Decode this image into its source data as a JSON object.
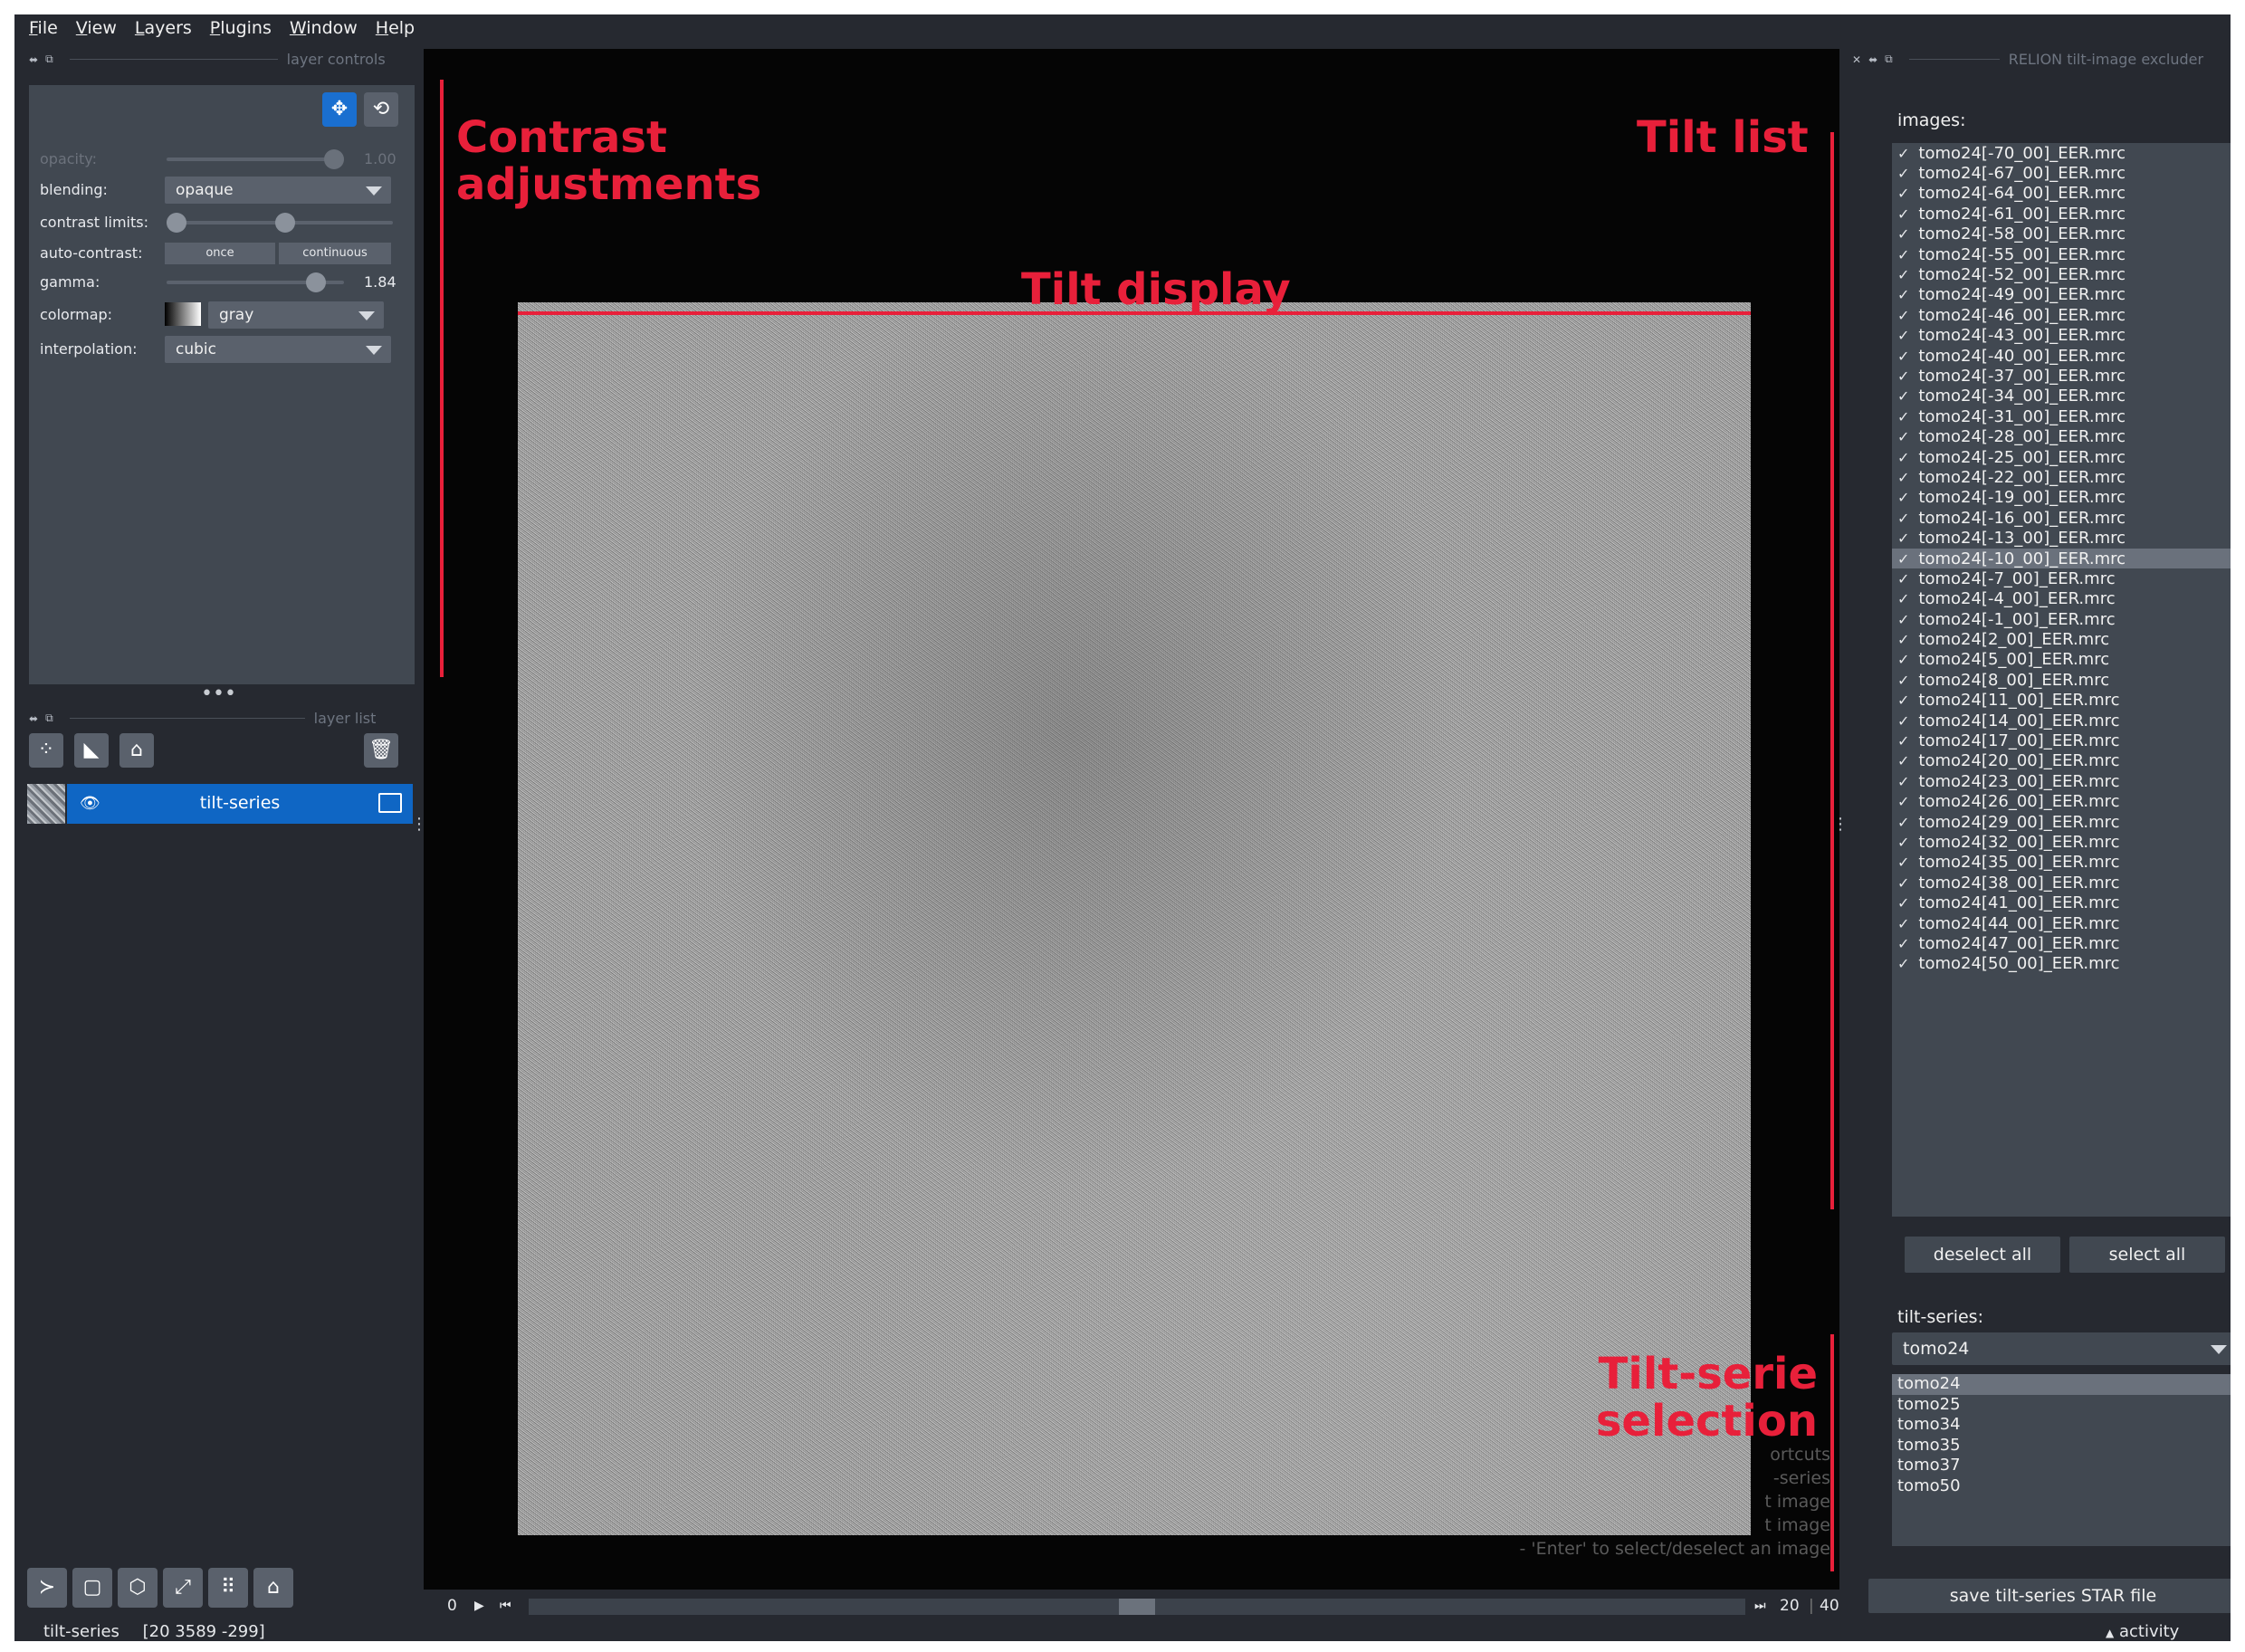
{
  "menu": [
    "File",
    "View",
    "Layers",
    "Plugins",
    "Window",
    "Help"
  ],
  "menu_underline": [
    "F",
    "V",
    "L",
    "P",
    "W",
    "H"
  ],
  "layer_controls": {
    "title": "layer controls",
    "opacity_label": "opacity:",
    "opacity_value": "1.00",
    "blending_label": "blending:",
    "blending_value": "opaque",
    "contrast_label": "contrast limits:",
    "auto_contrast_label": "auto-contrast:",
    "auto_once": "once",
    "auto_continuous": "continuous",
    "gamma_label": "gamma:",
    "gamma_value": "1.84",
    "colormap_label": "colormap:",
    "colormap_value": "gray",
    "interpolation_label": "interpolation:",
    "interpolation_value": "cubic"
  },
  "layer_list": {
    "title": "layer list",
    "layer_name": "tilt-series"
  },
  "status": {
    "layer": "tilt-series",
    "coords": "[20 3589 -299]"
  },
  "annotations": {
    "contrast_1": "Contrast",
    "contrast_2": "adjustments",
    "tilt_display": "Tilt display",
    "tilt_list": "Tilt list",
    "tilt_serie_1": "Tilt-serie",
    "tilt_serie_2": "selection"
  },
  "help_lines": [
    "ortcuts",
    "-series",
    "t image",
    "t image",
    "- 'Enter' to select/deselect an image"
  ],
  "dims": {
    "start": "0",
    "current": "20",
    "end": "40",
    "position": 0.5
  },
  "right_dock": {
    "title": "RELION tilt-image excluder",
    "images_label": "images:",
    "images": [
      "tomo24[-70_00]_EER.mrc",
      "tomo24[-67_00]_EER.mrc",
      "tomo24[-64_00]_EER.mrc",
      "tomo24[-61_00]_EER.mrc",
      "tomo24[-58_00]_EER.mrc",
      "tomo24[-55_00]_EER.mrc",
      "tomo24[-52_00]_EER.mrc",
      "tomo24[-49_00]_EER.mrc",
      "tomo24[-46_00]_EER.mrc",
      "tomo24[-43_00]_EER.mrc",
      "tomo24[-40_00]_EER.mrc",
      "tomo24[-37_00]_EER.mrc",
      "tomo24[-34_00]_EER.mrc",
      "tomo24[-31_00]_EER.mrc",
      "tomo24[-28_00]_EER.mrc",
      "tomo24[-25_00]_EER.mrc",
      "tomo24[-22_00]_EER.mrc",
      "tomo24[-19_00]_EER.mrc",
      "tomo24[-16_00]_EER.mrc",
      "tomo24[-13_00]_EER.mrc",
      "tomo24[-10_00]_EER.mrc",
      "tomo24[-7_00]_EER.mrc",
      "tomo24[-4_00]_EER.mrc",
      "tomo24[-1_00]_EER.mrc",
      "tomo24[2_00]_EER.mrc",
      "tomo24[5_00]_EER.mrc",
      "tomo24[8_00]_EER.mrc",
      "tomo24[11_00]_EER.mrc",
      "tomo24[14_00]_EER.mrc",
      "tomo24[17_00]_EER.mrc",
      "tomo24[20_00]_EER.mrc",
      "tomo24[23_00]_EER.mrc",
      "tomo24[26_00]_EER.mrc",
      "tomo24[29_00]_EER.mrc",
      "tomo24[32_00]_EER.mrc",
      "tomo24[35_00]_EER.mrc",
      "tomo24[38_00]_EER.mrc",
      "tomo24[41_00]_EER.mrc",
      "tomo24[44_00]_EER.mrc",
      "tomo24[47_00]_EER.mrc",
      "tomo24[50_00]_EER.mrc"
    ],
    "selected_image_index": 20,
    "check_mark": "✓",
    "deselect_all": "deselect all",
    "select_all": "select all",
    "tilt_series_label": "tilt-series:",
    "tilt_series_value": "tomo24",
    "tilt_series": [
      "tomo24",
      "tomo25",
      "tomo34",
      "tomo35",
      "tomo37",
      "tomo50"
    ],
    "selected_series_index": 0,
    "save_button": "save tilt-series STAR file",
    "activity": "activity"
  },
  "colors": {
    "accent": "#0f66c4",
    "annotation_red": "#e8203a",
    "panel_bg": "#262930",
    "widget_bg": "#414851"
  }
}
